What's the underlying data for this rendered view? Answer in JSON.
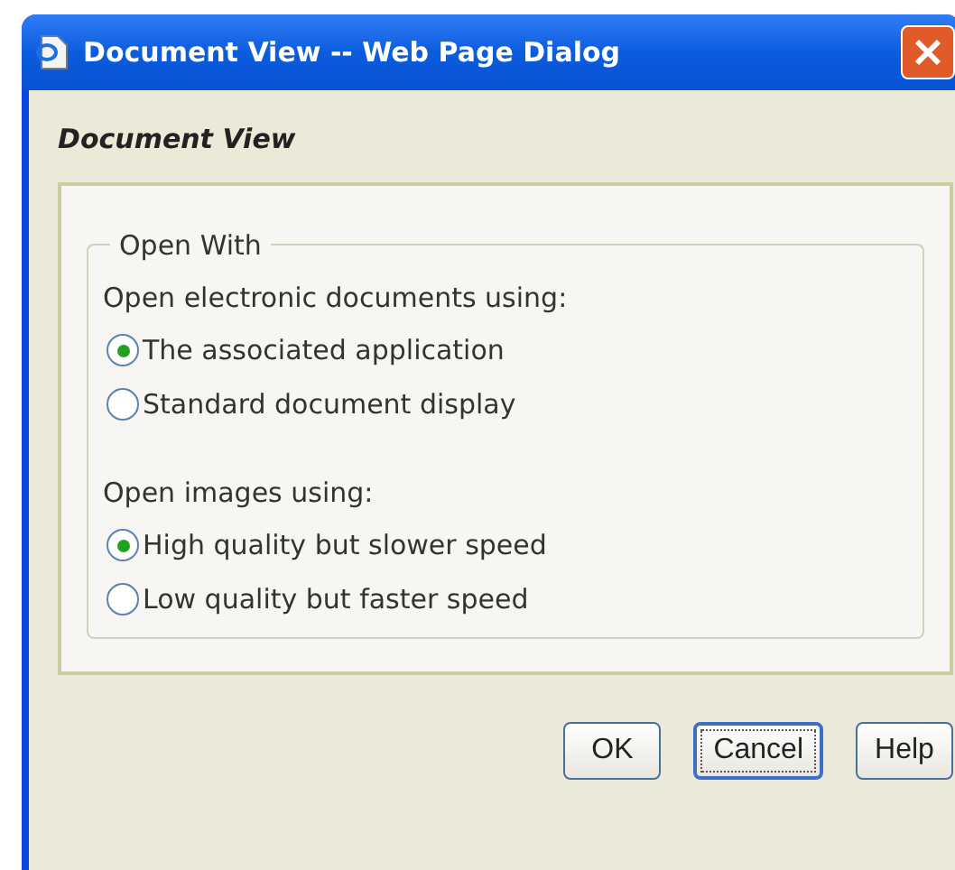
{
  "window": {
    "title": "Document View -- Web Page Dialog"
  },
  "heading": "Document View",
  "group": {
    "legend": "Open With",
    "sections": [
      {
        "label": "Open electronic documents using:",
        "options": [
          {
            "label": "The associated application",
            "selected": true
          },
          {
            "label": "Standard document display",
            "selected": false
          }
        ]
      },
      {
        "label": "Open images using:",
        "options": [
          {
            "label": "High quality but slower speed",
            "selected": true
          },
          {
            "label": "Low quality but faster speed",
            "selected": false
          }
        ]
      }
    ]
  },
  "buttons": [
    {
      "label": "OK",
      "focused": false
    },
    {
      "label": "Cancel",
      "focused": true
    },
    {
      "label": "Help",
      "focused": false
    }
  ]
}
